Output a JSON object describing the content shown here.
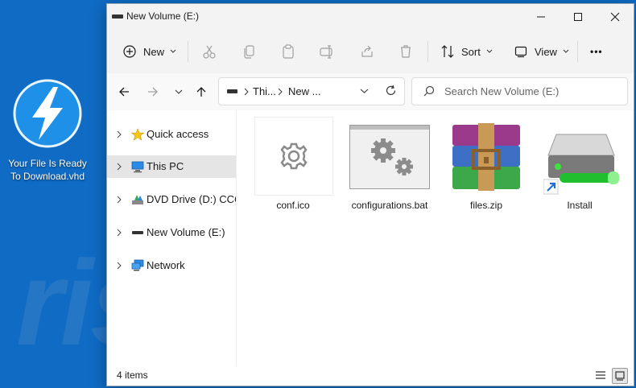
{
  "desktop": {
    "icon_label_line1": "Your File Is Ready",
    "icon_label_line2": "To Download.vhd",
    "accent": "#1e90e8"
  },
  "window": {
    "title": "New Volume (E:)"
  },
  "toolbar": {
    "new_label": "New",
    "sort_label": "Sort",
    "view_label": "View",
    "more_label": "•••"
  },
  "address": {
    "crumb1": "Thi...",
    "crumb2": "New ..."
  },
  "search": {
    "placeholder": "Search New Volume (E:)"
  },
  "nav": {
    "items": [
      {
        "label": "Quick access"
      },
      {
        "label": "This PC"
      },
      {
        "label": "DVD Drive (D:) CCCC"
      },
      {
        "label": "New Volume (E:)"
      },
      {
        "label": "Network"
      }
    ]
  },
  "files": [
    {
      "name": "conf.ico"
    },
    {
      "name": "configurations.bat"
    },
    {
      "name": "files.zip"
    },
    {
      "name": "Install"
    }
  ],
  "status": {
    "count": "4 items"
  },
  "watermark": "risk.com"
}
